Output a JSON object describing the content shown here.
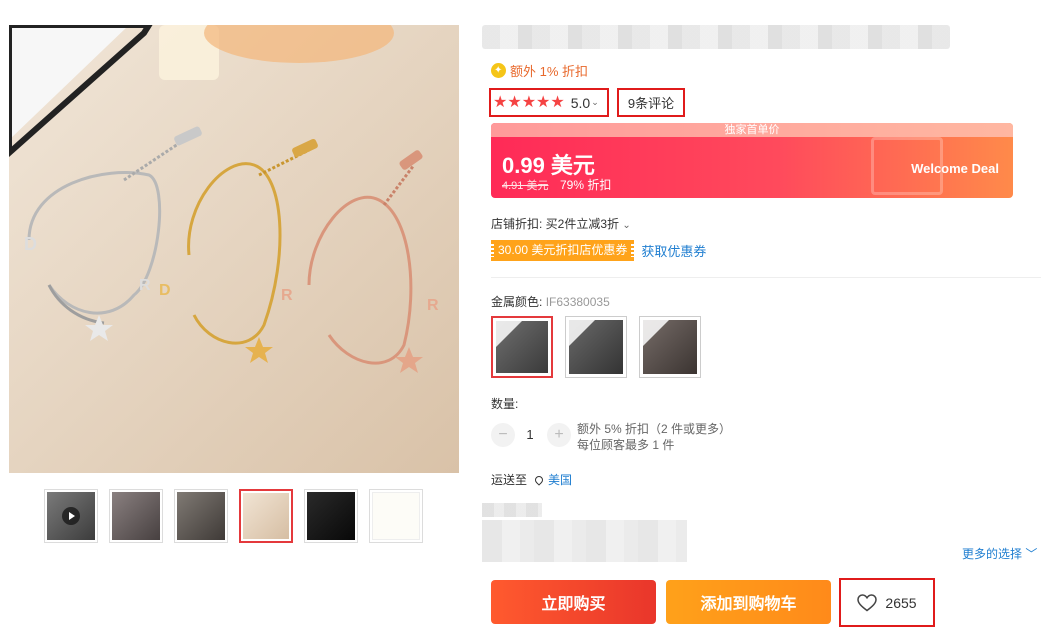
{
  "product": {
    "extra_discount": "额外 1% 折扣",
    "rating": {
      "stars": "★★★★★",
      "value": "5.0",
      "max": 5
    },
    "reviews_label": "9条评论",
    "deal": {
      "banner_top": "独家首单价",
      "price": "0.99 美元",
      "original_price": "4.91 美元",
      "discount": "79% 折扣",
      "label": "Welcome Deal"
    },
    "store_discount": "店铺折扣:  买2件立减3折",
    "coupon": {
      "label": "30.00 美元折扣店优惠券",
      "action": "获取优惠券"
    },
    "color": {
      "label": "金属颜色:",
      "sku": "IF63380035"
    },
    "quantity": {
      "label": "数量:",
      "value": "1",
      "minus": "−",
      "plus": "+",
      "note_line1": "额外 5% 折扣（2 件或更多）",
      "note_line2": "每位顾客最多 1 件"
    },
    "shipping": {
      "label": "运送至",
      "country": "美国"
    },
    "more_options": "更多的选择",
    "buttons": {
      "buy_now": "立即购买",
      "add_to_cart": "添加到购物车",
      "wishlist_count": "2655"
    }
  },
  "colors": {
    "accent_red": "#e4393c",
    "link_blue": "#1f7ed0",
    "coupon_orange": "#ffa31a"
  }
}
